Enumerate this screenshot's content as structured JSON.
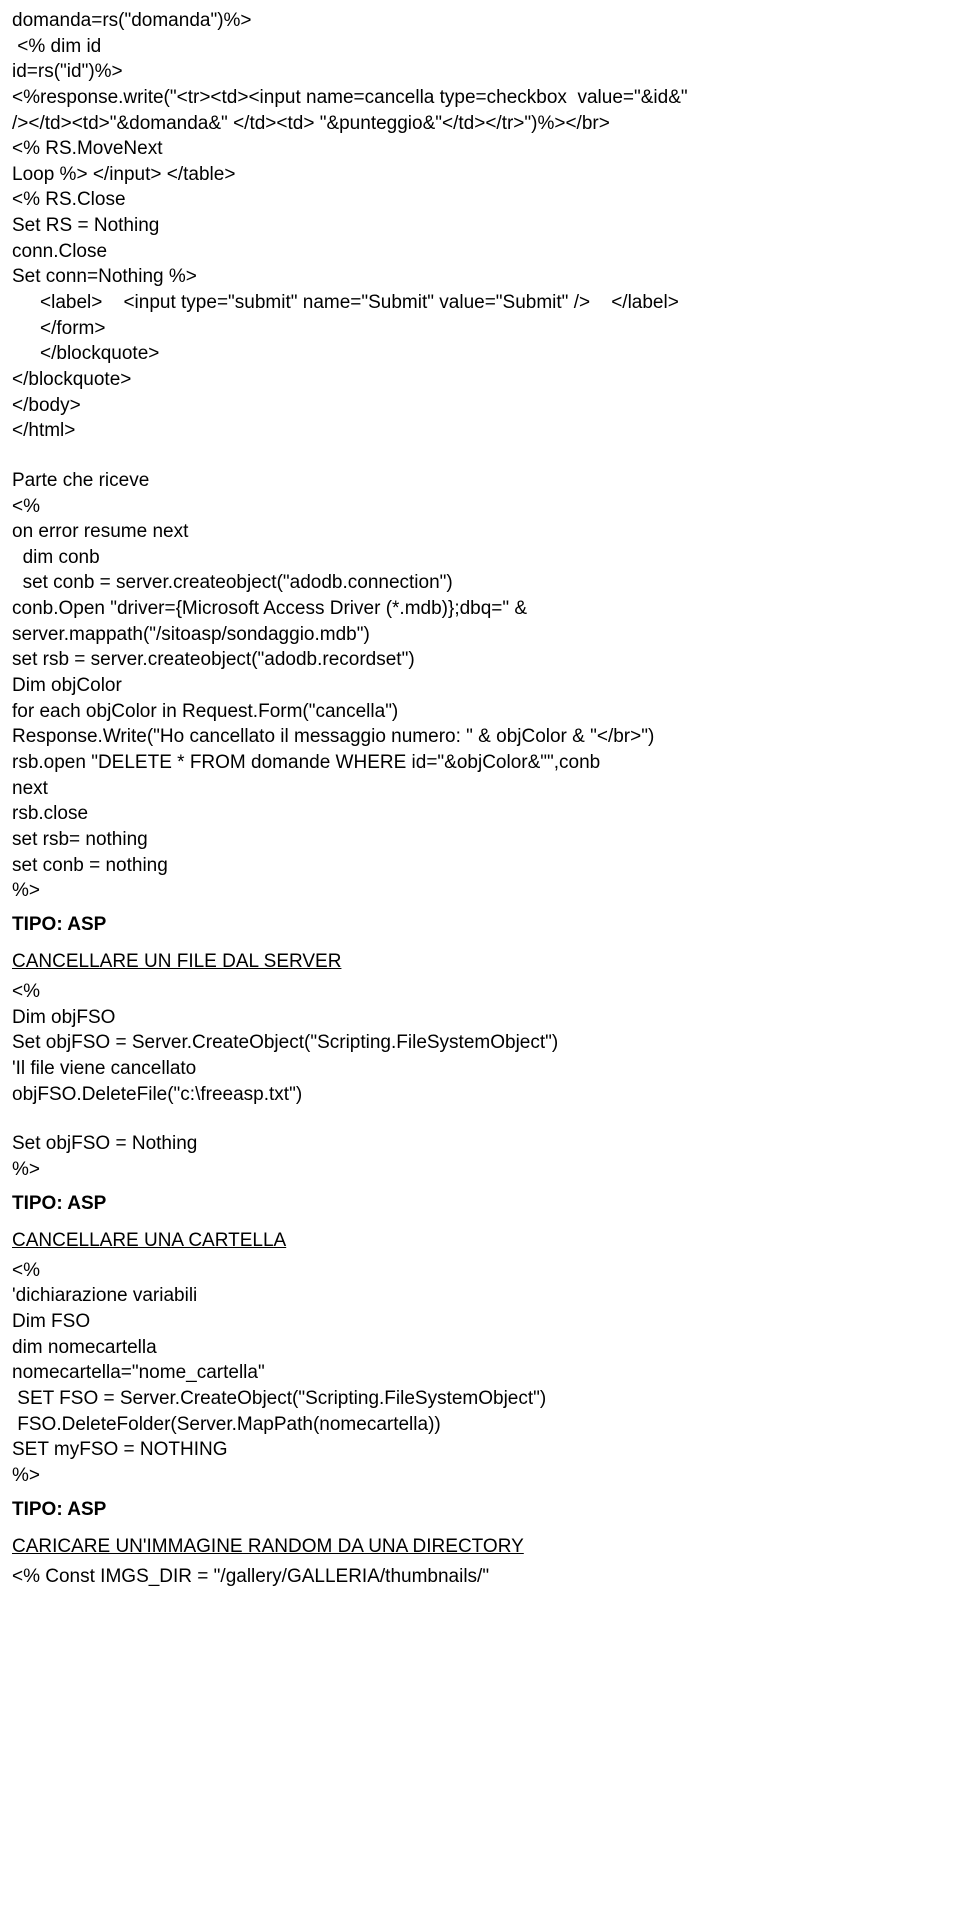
{
  "lines": [
    {
      "text": "domanda=rs(\"domanda\")%>",
      "class": "line"
    },
    {
      "text": " <% dim id",
      "class": "line"
    },
    {
      "text": "id=rs(\"id\")%>",
      "class": "line"
    },
    {
      "text": "<%response.write(\"<tr><td><input name=cancella type=checkbox  value=\"&id&\"",
      "class": "line"
    },
    {
      "text": "/></td><td>\"&domanda&\" </td><td> \"&punteggio&\"</td></tr>\")%></br>",
      "class": "line"
    },
    {
      "text": "<% RS.MoveNext",
      "class": "line"
    },
    {
      "text": "Loop %> </input> </table>",
      "class": "line"
    },
    {
      "text": "<% RS.Close",
      "class": "line"
    },
    {
      "text": "Set RS = Nothing",
      "class": "line"
    },
    {
      "text": "conn.Close",
      "class": "line"
    },
    {
      "text": "Set conn=Nothing %>",
      "class": "line"
    },
    {
      "text": "<label>    <input type=\"submit\" name=\"Submit\" value=\"Submit\" />    </label>",
      "class": "line indent1"
    },
    {
      "text": "</form>",
      "class": "line indent1"
    },
    {
      "text": "</blockquote>",
      "class": "line indent1"
    },
    {
      "text": "</blockquote>",
      "class": "line"
    },
    {
      "text": "</body>",
      "class": "line"
    },
    {
      "text": "</html>",
      "class": "line"
    },
    {
      "text": "",
      "class": "spacer"
    },
    {
      "text": "Parte che riceve",
      "class": "line"
    },
    {
      "text": "<%",
      "class": "line"
    },
    {
      "text": "on error resume next",
      "class": "line"
    },
    {
      "text": "  dim conb",
      "class": "line"
    },
    {
      "text": "  set conb = server.createobject(\"adodb.connection\")",
      "class": "line"
    },
    {
      "text": "conb.Open \"driver={Microsoft Access Driver (*.mdb)};dbq=\" &",
      "class": "line"
    },
    {
      "text": "server.mappath(\"/sitoasp/sondaggio.mdb\")",
      "class": "line"
    },
    {
      "text": "set rsb = server.createobject(\"adodb.recordset\")",
      "class": "line"
    },
    {
      "text": "Dim objColor",
      "class": "line"
    },
    {
      "text": "for each objColor in Request.Form(\"cancella\")",
      "class": "line"
    },
    {
      "text": "Response.Write(\"Ho cancellato il messaggio numero: \" & objColor & \"</br>\")",
      "class": "line"
    },
    {
      "text": "rsb.open \"DELETE * FROM domande WHERE id=\"&objColor&\"\",conb",
      "class": "line"
    },
    {
      "text": "next",
      "class": "line"
    },
    {
      "text": "rsb.close",
      "class": "line"
    },
    {
      "text": "set rsb= nothing",
      "class": "line"
    },
    {
      "text": "set conb = nothing",
      "class": "line"
    },
    {
      "text": "%>",
      "class": "line"
    },
    {
      "text": "TIPO: ASP",
      "class": "line bold",
      "pad": true
    },
    {
      "text": "CANCELLARE UN FILE DAL SERVER",
      "class": "line underline",
      "pad": true
    },
    {
      "text": "<%",
      "class": "line"
    },
    {
      "text": "Dim objFSO",
      "class": "line"
    },
    {
      "text": "Set objFSO = Server.CreateObject(\"Scripting.FileSystemObject\")",
      "class": "line"
    },
    {
      "text": "'Il file viene cancellato",
      "class": "line"
    },
    {
      "text": "objFSO.DeleteFile(\"c:\\freeasp.txt\")",
      "class": "line"
    },
    {
      "text": "",
      "class": "spacer"
    },
    {
      "text": "Set objFSO = Nothing",
      "class": "line"
    },
    {
      "text": "%>",
      "class": "line"
    },
    {
      "text": "TIPO: ASP",
      "class": "line bold",
      "pad": true
    },
    {
      "text": "CANCELLARE UNA CARTELLA",
      "class": "line underline",
      "pad": true
    },
    {
      "text": "<%",
      "class": "line"
    },
    {
      "text": "'dichiarazione variabili",
      "class": "line"
    },
    {
      "text": "Dim FSO",
      "class": "line"
    },
    {
      "text": "dim nomecartella",
      "class": "line"
    },
    {
      "text": "nomecartella=\"nome_cartella\"",
      "class": "line"
    },
    {
      "text": " SET FSO = Server.CreateObject(\"Scripting.FileSystemObject\")",
      "class": "line"
    },
    {
      "text": " FSO.DeleteFolder(Server.MapPath(nomecartella))",
      "class": "line"
    },
    {
      "text": "SET myFSO = NOTHING",
      "class": "line"
    },
    {
      "text": "%>",
      "class": "line"
    },
    {
      "text": "TIPO: ASP",
      "class": "line bold",
      "pad": true
    },
    {
      "text": "CARICARE UN'IMMAGINE RANDOM DA UNA DIRECTORY",
      "class": "line underline",
      "pad": true
    },
    {
      "text": "<% Const IMGS_DIR = \"/gallery/GALLERIA/thumbnails/\"",
      "class": "line"
    }
  ]
}
